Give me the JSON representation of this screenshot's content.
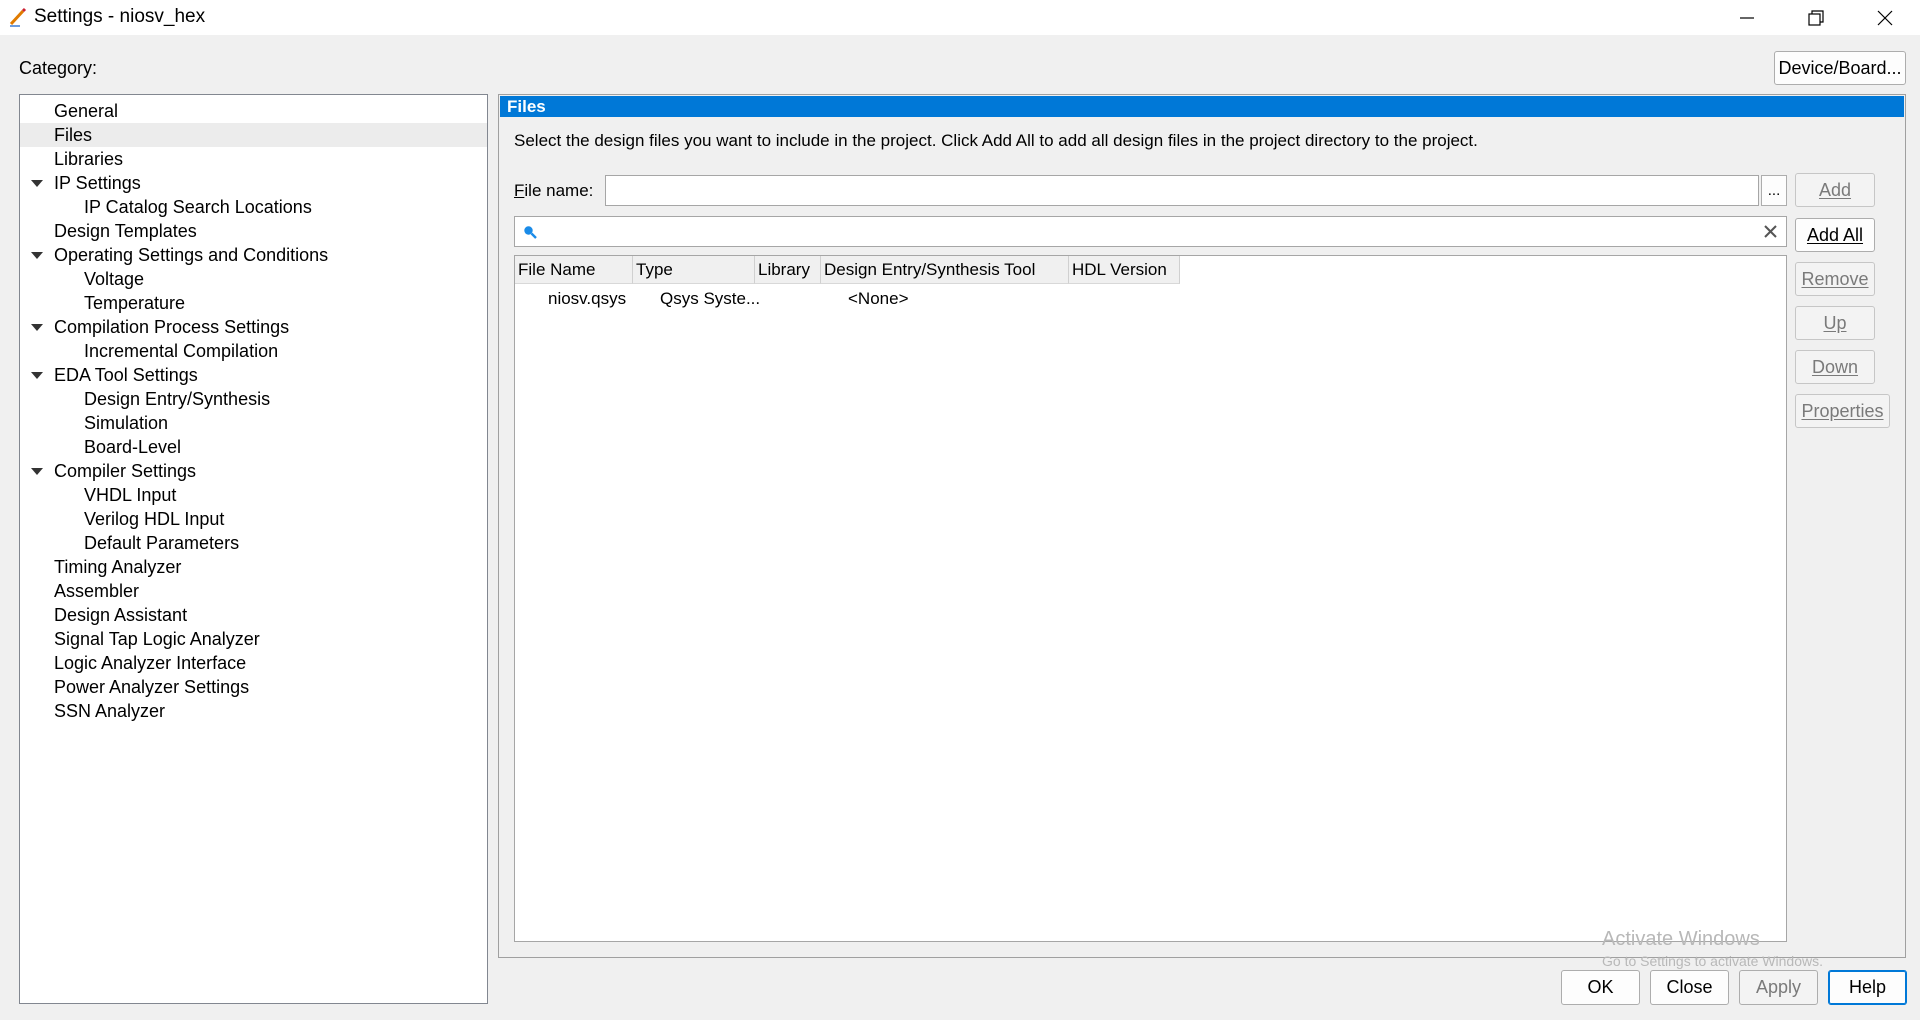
{
  "window": {
    "title": "Settings - niosv_hex",
    "controls": [
      "minimize-icon",
      "restore-icon",
      "close-icon"
    ]
  },
  "category_label": "Category:",
  "device_board_button": "Device/Board...",
  "tree": {
    "items": [
      {
        "label": "General",
        "level": 0,
        "expandable": false,
        "selected": false
      },
      {
        "label": "Files",
        "level": 0,
        "expandable": false,
        "selected": true
      },
      {
        "label": "Libraries",
        "level": 0,
        "expandable": false,
        "selected": false
      },
      {
        "label": "IP Settings",
        "level": 0,
        "expandable": true,
        "selected": false
      },
      {
        "label": "IP Catalog Search Locations",
        "level": 1,
        "expandable": false,
        "selected": false
      },
      {
        "label": "Design Templates",
        "level": 0,
        "expandable": false,
        "selected": false
      },
      {
        "label": "Operating Settings and Conditions",
        "level": 0,
        "expandable": true,
        "selected": false
      },
      {
        "label": "Voltage",
        "level": 1,
        "expandable": false,
        "selected": false
      },
      {
        "label": "Temperature",
        "level": 1,
        "expandable": false,
        "selected": false
      },
      {
        "label": "Compilation Process Settings",
        "level": 0,
        "expandable": true,
        "selected": false
      },
      {
        "label": "Incremental Compilation",
        "level": 1,
        "expandable": false,
        "selected": false
      },
      {
        "label": "EDA Tool Settings",
        "level": 0,
        "expandable": true,
        "selected": false
      },
      {
        "label": "Design Entry/Synthesis",
        "level": 1,
        "expandable": false,
        "selected": false
      },
      {
        "label": "Simulation",
        "level": 1,
        "expandable": false,
        "selected": false
      },
      {
        "label": "Board-Level",
        "level": 1,
        "expandable": false,
        "selected": false
      },
      {
        "label": "Compiler Settings",
        "level": 0,
        "expandable": true,
        "selected": false
      },
      {
        "label": "VHDL Input",
        "level": 1,
        "expandable": false,
        "selected": false
      },
      {
        "label": "Verilog HDL Input",
        "level": 1,
        "expandable": false,
        "selected": false
      },
      {
        "label": "Default Parameters",
        "level": 1,
        "expandable": false,
        "selected": false
      },
      {
        "label": "Timing Analyzer",
        "level": 0,
        "expandable": false,
        "selected": false
      },
      {
        "label": "Assembler",
        "level": 0,
        "expandable": false,
        "selected": false
      },
      {
        "label": "Design Assistant",
        "level": 0,
        "expandable": false,
        "selected": false
      },
      {
        "label": "Signal Tap Logic Analyzer",
        "level": 0,
        "expandable": false,
        "selected": false
      },
      {
        "label": "Logic Analyzer Interface",
        "level": 0,
        "expandable": false,
        "selected": false
      },
      {
        "label": "Power Analyzer Settings",
        "level": 0,
        "expandable": false,
        "selected": false
      },
      {
        "label": "SSN Analyzer",
        "level": 0,
        "expandable": false,
        "selected": false
      }
    ]
  },
  "panel": {
    "header": "Files",
    "description": "Select the design files you want to include in the project. Click Add All to add all design files in the project directory to the project.",
    "file_name_label": "File name:",
    "file_name_value": "",
    "browse_label": "...",
    "search_value": "",
    "table": {
      "columns": [
        "File Name",
        "Type",
        "Library",
        "Design Entry/Synthesis Tool",
        "HDL Version"
      ],
      "rows": [
        [
          "niosv.qsys",
          "Qsys Syste...",
          "",
          "<None>",
          ""
        ]
      ]
    },
    "side_buttons": [
      {
        "label": "Add",
        "enabled": false
      },
      {
        "label": "Add All",
        "enabled": true
      },
      {
        "label": "Remove",
        "enabled": false
      },
      {
        "label": "Up",
        "enabled": false
      },
      {
        "label": "Down",
        "enabled": false
      },
      {
        "label": "Properties",
        "enabled": false
      }
    ]
  },
  "footer": {
    "ok": "OK",
    "close": "Close",
    "apply": "Apply",
    "help": "Help"
  },
  "watermark": {
    "line1": "Activate Windows",
    "line2": "Go to Settings to activate Windows."
  },
  "colors": {
    "header_blue": "#0078d7",
    "selected_row": "#ececec"
  }
}
